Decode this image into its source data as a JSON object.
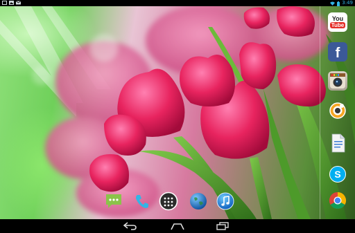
{
  "status_bar": {
    "time": "3:49",
    "left_icons": [
      "screenshot-icon",
      "image-icon",
      "email-icon"
    ],
    "right_icons": [
      "wifi-icon",
      "battery-icon"
    ]
  },
  "dock": {
    "items": [
      {
        "name": "messaging",
        "icon": "message-icon"
      },
      {
        "name": "phone",
        "icon": "phone-icon"
      },
      {
        "name": "all-apps",
        "icon": "app-drawer-icon"
      },
      {
        "name": "browser",
        "icon": "globe-icon"
      },
      {
        "name": "music",
        "icon": "music-icon"
      }
    ]
  },
  "side_dock": {
    "items": [
      {
        "name": "youtube",
        "label_line1": "You",
        "label_line2": "Tube",
        "icon": "youtube-icon"
      },
      {
        "name": "facebook",
        "label": "f",
        "icon": "facebook-icon"
      },
      {
        "name": "camera",
        "icon": "camera-icon"
      },
      {
        "name": "screencast",
        "icon": "screencast-icon"
      },
      {
        "name": "notes",
        "icon": "document-icon"
      },
      {
        "name": "skype",
        "label": "S",
        "icon": "skype-icon"
      },
      {
        "name": "chrome",
        "icon": "chrome-icon"
      }
    ]
  },
  "nav_bar": {
    "buttons": [
      {
        "name": "back",
        "icon": "back-icon"
      },
      {
        "name": "home",
        "icon": "home-icon"
      },
      {
        "name": "recents",
        "icon": "recents-icon"
      }
    ]
  },
  "colors": {
    "youtube_red": "#e52d27",
    "facebook_blue": "#3b5998",
    "skype_blue": "#00aff0",
    "phone_blue": "#33b5e5",
    "message_green": "#8bc34a"
  }
}
